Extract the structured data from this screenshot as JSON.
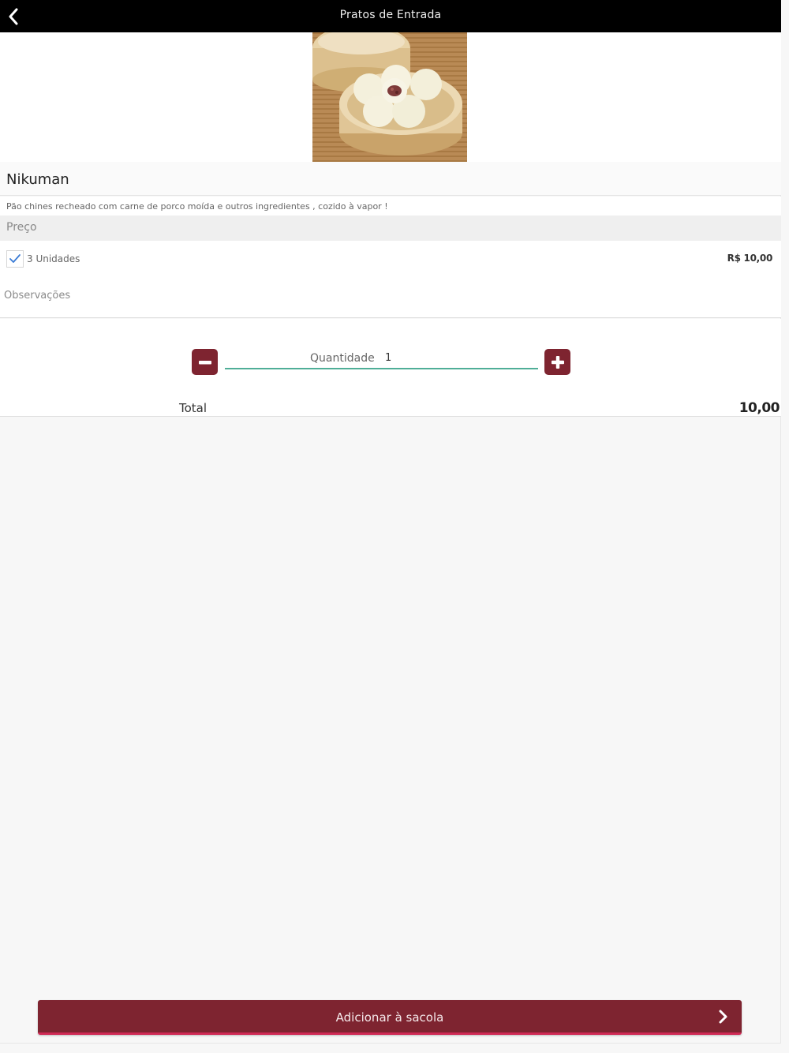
{
  "header": {
    "title": "Pratos de Entrada",
    "back_icon": "chevron-left-icon"
  },
  "product": {
    "image_alt": "Nikuman",
    "name": "Nikuman",
    "description": "Pão chines recheado com carne de porco moída e outros ingredientes , cozido à vapor !"
  },
  "price_section": {
    "title": "Preço",
    "options": [
      {
        "label": "3 Unidades",
        "price": "R$ 10,00",
        "checked": true
      }
    ]
  },
  "observations": {
    "placeholder": "Observações",
    "value": ""
  },
  "quantity": {
    "label": "Quantidade",
    "value": "1",
    "minus_icon": "minus-icon",
    "plus_icon": "plus-icon"
  },
  "total": {
    "label": "Total",
    "value": "10,00"
  },
  "cta": {
    "label": "Adicionar à sacola",
    "icon": "chevron-right-icon"
  },
  "colors": {
    "brand": "#7e2430",
    "accent_underline": "#4fae97",
    "topbar": "#000000",
    "check": "#3a7bd5"
  }
}
